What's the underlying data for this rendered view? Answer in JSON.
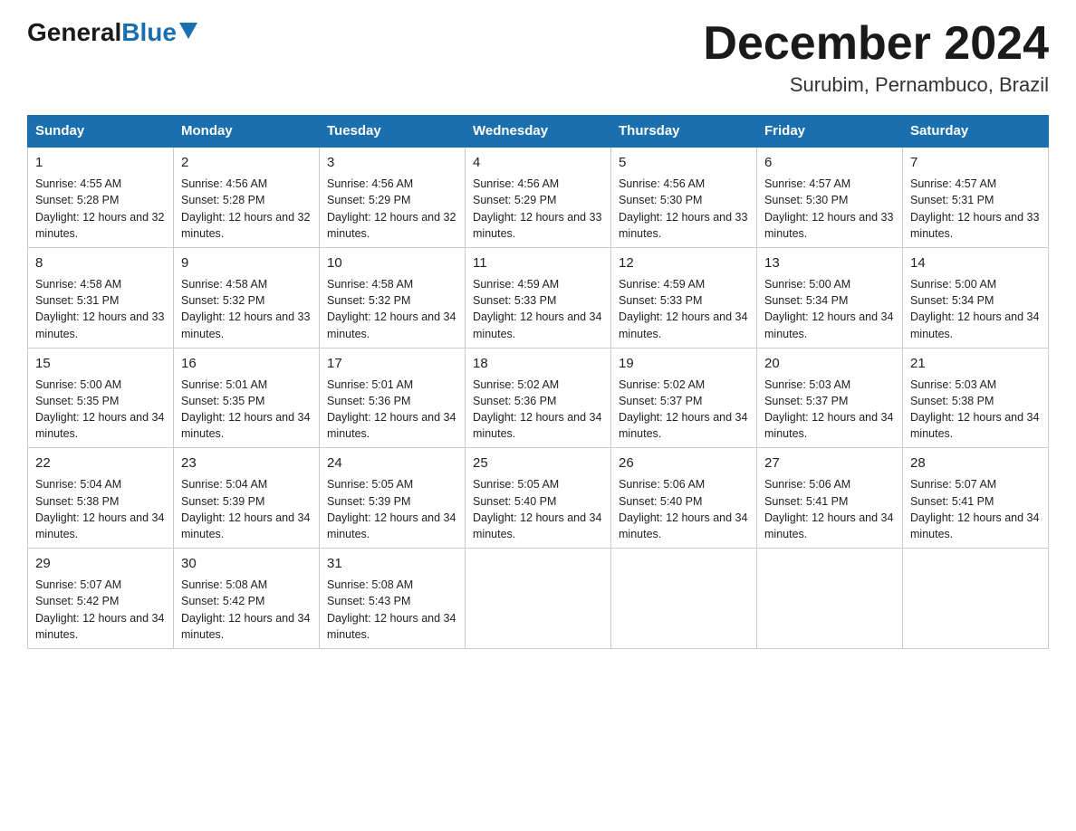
{
  "logo": {
    "general": "General",
    "blue": "Blue"
  },
  "title": "December 2024",
  "location": "Surubim, Pernambuco, Brazil",
  "days_of_week": [
    "Sunday",
    "Monday",
    "Tuesday",
    "Wednesday",
    "Thursday",
    "Friday",
    "Saturday"
  ],
  "weeks": [
    [
      {
        "day": "1",
        "sunrise": "4:55 AM",
        "sunset": "5:28 PM",
        "daylight": "12 hours and 32 minutes."
      },
      {
        "day": "2",
        "sunrise": "4:56 AM",
        "sunset": "5:28 PM",
        "daylight": "12 hours and 32 minutes."
      },
      {
        "day": "3",
        "sunrise": "4:56 AM",
        "sunset": "5:29 PM",
        "daylight": "12 hours and 32 minutes."
      },
      {
        "day": "4",
        "sunrise": "4:56 AM",
        "sunset": "5:29 PM",
        "daylight": "12 hours and 33 minutes."
      },
      {
        "day": "5",
        "sunrise": "4:56 AM",
        "sunset": "5:30 PM",
        "daylight": "12 hours and 33 minutes."
      },
      {
        "day": "6",
        "sunrise": "4:57 AM",
        "sunset": "5:30 PM",
        "daylight": "12 hours and 33 minutes."
      },
      {
        "day": "7",
        "sunrise": "4:57 AM",
        "sunset": "5:31 PM",
        "daylight": "12 hours and 33 minutes."
      }
    ],
    [
      {
        "day": "8",
        "sunrise": "4:58 AM",
        "sunset": "5:31 PM",
        "daylight": "12 hours and 33 minutes."
      },
      {
        "day": "9",
        "sunrise": "4:58 AM",
        "sunset": "5:32 PM",
        "daylight": "12 hours and 33 minutes."
      },
      {
        "day": "10",
        "sunrise": "4:58 AM",
        "sunset": "5:32 PM",
        "daylight": "12 hours and 34 minutes."
      },
      {
        "day": "11",
        "sunrise": "4:59 AM",
        "sunset": "5:33 PM",
        "daylight": "12 hours and 34 minutes."
      },
      {
        "day": "12",
        "sunrise": "4:59 AM",
        "sunset": "5:33 PM",
        "daylight": "12 hours and 34 minutes."
      },
      {
        "day": "13",
        "sunrise": "5:00 AM",
        "sunset": "5:34 PM",
        "daylight": "12 hours and 34 minutes."
      },
      {
        "day": "14",
        "sunrise": "5:00 AM",
        "sunset": "5:34 PM",
        "daylight": "12 hours and 34 minutes."
      }
    ],
    [
      {
        "day": "15",
        "sunrise": "5:00 AM",
        "sunset": "5:35 PM",
        "daylight": "12 hours and 34 minutes."
      },
      {
        "day": "16",
        "sunrise": "5:01 AM",
        "sunset": "5:35 PM",
        "daylight": "12 hours and 34 minutes."
      },
      {
        "day": "17",
        "sunrise": "5:01 AM",
        "sunset": "5:36 PM",
        "daylight": "12 hours and 34 minutes."
      },
      {
        "day": "18",
        "sunrise": "5:02 AM",
        "sunset": "5:36 PM",
        "daylight": "12 hours and 34 minutes."
      },
      {
        "day": "19",
        "sunrise": "5:02 AM",
        "sunset": "5:37 PM",
        "daylight": "12 hours and 34 minutes."
      },
      {
        "day": "20",
        "sunrise": "5:03 AM",
        "sunset": "5:37 PM",
        "daylight": "12 hours and 34 minutes."
      },
      {
        "day": "21",
        "sunrise": "5:03 AM",
        "sunset": "5:38 PM",
        "daylight": "12 hours and 34 minutes."
      }
    ],
    [
      {
        "day": "22",
        "sunrise": "5:04 AM",
        "sunset": "5:38 PM",
        "daylight": "12 hours and 34 minutes."
      },
      {
        "day": "23",
        "sunrise": "5:04 AM",
        "sunset": "5:39 PM",
        "daylight": "12 hours and 34 minutes."
      },
      {
        "day": "24",
        "sunrise": "5:05 AM",
        "sunset": "5:39 PM",
        "daylight": "12 hours and 34 minutes."
      },
      {
        "day": "25",
        "sunrise": "5:05 AM",
        "sunset": "5:40 PM",
        "daylight": "12 hours and 34 minutes."
      },
      {
        "day": "26",
        "sunrise": "5:06 AM",
        "sunset": "5:40 PM",
        "daylight": "12 hours and 34 minutes."
      },
      {
        "day": "27",
        "sunrise": "5:06 AM",
        "sunset": "5:41 PM",
        "daylight": "12 hours and 34 minutes."
      },
      {
        "day": "28",
        "sunrise": "5:07 AM",
        "sunset": "5:41 PM",
        "daylight": "12 hours and 34 minutes."
      }
    ],
    [
      {
        "day": "29",
        "sunrise": "5:07 AM",
        "sunset": "5:42 PM",
        "daylight": "12 hours and 34 minutes."
      },
      {
        "day": "30",
        "sunrise": "5:08 AM",
        "sunset": "5:42 PM",
        "daylight": "12 hours and 34 minutes."
      },
      {
        "day": "31",
        "sunrise": "5:08 AM",
        "sunset": "5:43 PM",
        "daylight": "12 hours and 34 minutes."
      },
      null,
      null,
      null,
      null
    ]
  ]
}
